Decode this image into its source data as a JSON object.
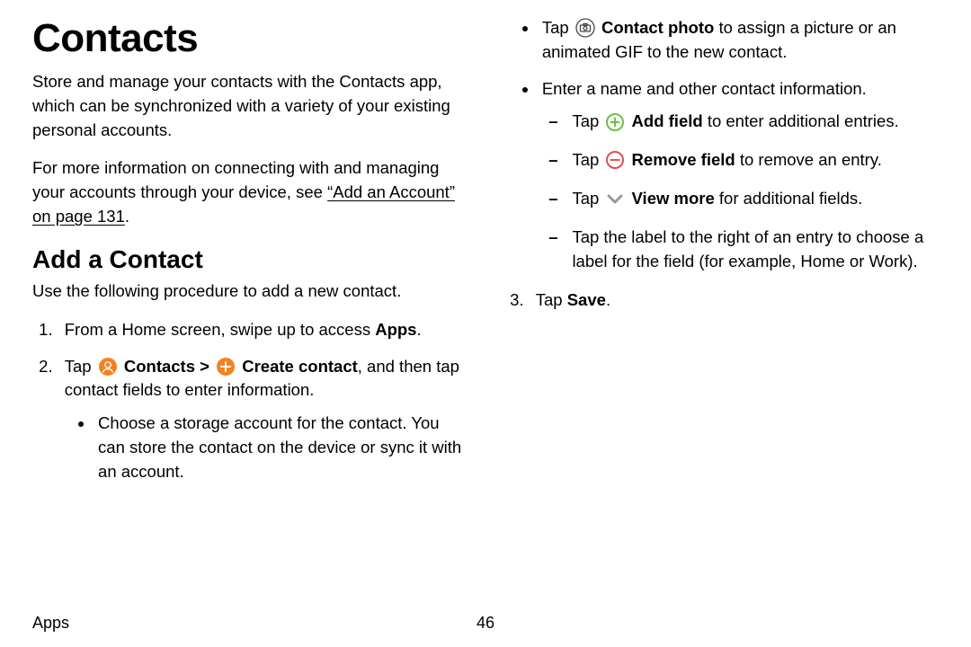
{
  "title": "Contacts",
  "intro1": "Store and manage your contacts with the Contacts app, which can be synchronized with a variety of your existing personal accounts.",
  "intro2_pre": "For more information on connecting with and managing your accounts through your device, see ",
  "intro2_link": "“Add an Account” on page 131",
  "intro2_post": ".",
  "section_add": "Add a Contact",
  "add_desc": "Use the following procedure to add a new contact.",
  "step1_a": "From a Home screen, swipe up to access ",
  "step1_b": "Apps",
  "step1_c": ".",
  "step2_a": "Tap ",
  "step2_b": "Contacts",
  "step2_sep": " > ",
  "step2_c": "Create contact",
  "step2_d": ", and then tap contact fields to enter information.",
  "step2_b1": "Choose a storage account for the contact. You can store the contact on the device or sync it with an account.",
  "step2_b2_a": "Tap ",
  "step2_b2_b": "Contact photo",
  "step2_b2_c": " to assign a picture or an animated GIF to the new contact.",
  "step2_b3": "Enter a name and other contact information.",
  "dash1_a": "Tap ",
  "dash1_b": "Add field",
  "dash1_c": " to enter additional entries.",
  "dash2_a": "Tap ",
  "dash2_b": "Remove field",
  "dash2_c": " to remove an entry.",
  "dash3_a": "Tap ",
  "dash3_b": "View more",
  "dash3_c": " for additional fields.",
  "dash4": "Tap the label to the right of an entry to choose a label for the field (for example, Home or Work).",
  "step3_a": "Tap ",
  "step3_b": "Save",
  "step3_c": ".",
  "footer_section": "Apps",
  "page_number": "46",
  "icons": {
    "camera": "camera-outline-icon",
    "contacts": "contacts-app-icon",
    "plus_orange": "plus-filled-icon",
    "plus_green": "plus-outline-icon",
    "minus_red": "minus-outline-icon",
    "chevron_down": "chevron-down-icon"
  },
  "colors": {
    "orange": "#f58220",
    "green": "#6cbf47",
    "red": "#e25050",
    "grey": "#9a9a9a"
  }
}
